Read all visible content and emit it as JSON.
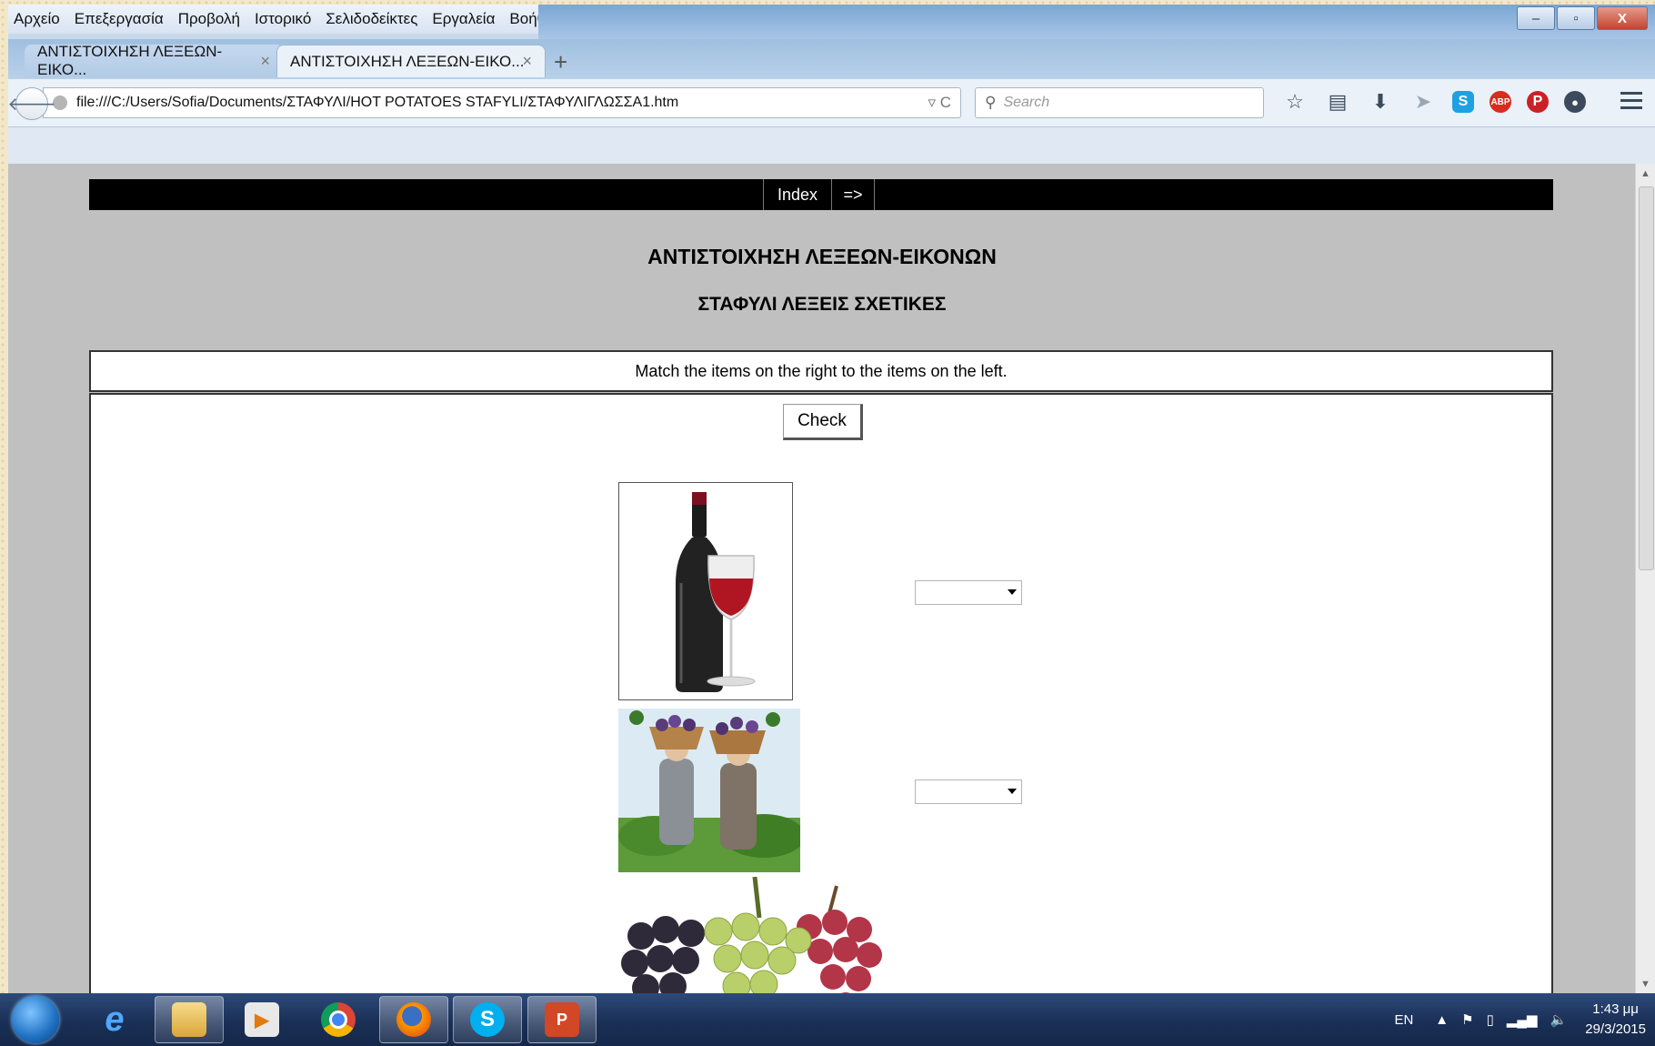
{
  "menu": [
    "Αρχείο",
    "Επεξεργασία",
    "Προβολή",
    "Ιστορικό",
    "Σελιδοδείκτες",
    "Εργαλεία",
    "Βοήθεια"
  ],
  "window_controls": {
    "minimize": "–",
    "maximize": "▫",
    "close": "X"
  },
  "tabs": [
    {
      "label": "ΑΝΤΙΣΤΟΙΧΗΣΗ ΛΕΞΕΩΝ-ΕΙΚΟ...",
      "active": false
    },
    {
      "label": "ΑΝΤΙΣΤΟΙΧΗΣΗ ΛΕΞΕΩΝ-ΕΙΚΟ...",
      "active": true
    }
  ],
  "new_tab_label": "+",
  "tab_close_glyph": "×",
  "nav": {
    "url": "file:///C:/Users/Sofia/Documents/ΣΤΑΦΥΛΙ/HOT POTATOES STAFYLI/ΣΤΑΦΥΛΙΓΛΩΣΣΑ1.htm",
    "url_right_glyphs": "▿ C",
    "search_placeholder": "Search"
  },
  "toolbar_icons": [
    "star-icon",
    "reading-list-icon",
    "download-icon",
    "send-icon",
    "skype-icon",
    "adblock-icon",
    "pinterest-icon",
    "chat-icon",
    "menu-icon"
  ],
  "page": {
    "nav_index": "Index",
    "nav_forward": "=>",
    "title": "ΑΝΤΙΣΤΟΙΧΗΣΗ ΛΕΞΕΩΝ-ΕΙΚΟΝΩΝ",
    "subtitle": "ΣΤΑΦΥΛΙ ΛΕΞΕΙΣ ΣΧΕΤΙΚΕΣ",
    "instructions": "Match the items on the right to the items on the left.",
    "check_label": "Check",
    "items": [
      {
        "image": "wine-bottle-and-glass",
        "selected": ""
      },
      {
        "image": "grape-harvest-women",
        "selected": ""
      },
      {
        "image": "grape-bunches",
        "selected": ""
      }
    ]
  },
  "taskbar": {
    "apps": [
      "internet-explorer",
      "file-explorer",
      "media-player",
      "chrome",
      "firefox",
      "skype",
      "powerpoint"
    ],
    "active_app": "firefox",
    "lang": "EN",
    "time": "1:43 μμ",
    "date": "29/3/2015"
  },
  "colors": {
    "page_bg": "#c0c0c0",
    "nav_bar": "#000000",
    "content_bg": "#ffffff"
  }
}
